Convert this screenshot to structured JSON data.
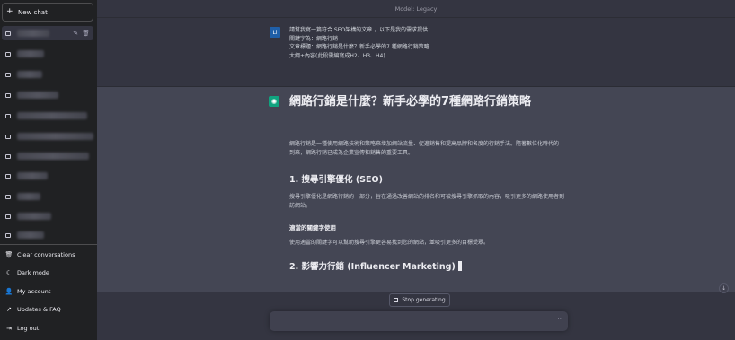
{
  "sidebar": {
    "new_chat_label": "New chat",
    "new_chat_icon": "plus-icon",
    "conversations": [
      {
        "label": "",
        "active": true
      },
      {
        "label": "",
        "active": false
      },
      {
        "label": "",
        "active": false
      },
      {
        "label": "",
        "active": false
      },
      {
        "label": "",
        "active": false
      },
      {
        "label": "",
        "active": false
      },
      {
        "label": "",
        "active": false
      },
      {
        "label": "",
        "active": false
      },
      {
        "label": "",
        "active": false
      },
      {
        "label": "",
        "active": false
      },
      {
        "label": "",
        "active": false
      }
    ],
    "menu": [
      {
        "icon": "trash-icon",
        "label": "Clear conversations"
      },
      {
        "icon": "moon-icon",
        "label": "Dark mode"
      },
      {
        "icon": "user-icon",
        "label": "My account"
      },
      {
        "icon": "external-link-icon",
        "label": "Updates & FAQ"
      },
      {
        "icon": "logout-icon",
        "label": "Log out"
      }
    ]
  },
  "header": {
    "model_label": "Model: Legacy"
  },
  "user_message": {
    "avatar": "Li",
    "lines": [
      "請幫我寫一篇符合 SEO架構的文章 ，以下是我的需求提供：",
      "關鍵字為：網路行銷",
      "文章標題：網路行銷是什麼？新手必學的7 種網路行銷策略",
      "大綱+內容(此段需編寫成H2、H3、H4)"
    ]
  },
  "assistant_message": {
    "title": "網路行銷是什麼？新手必學的7種網路行銷策略",
    "intro": "網路行銷是一種使用網路技術和策略來增加網站流量、促進銷售和提高品牌和名度的行銷手法。隨著數位化時代的到來，網路行銷已成為企業宣傳和銷售的重要工具。",
    "h2_seo": "1. 搜尋引擎優化 (SEO)",
    "seo_text": "搜尋引擎優化是網路行銷的一部分，旨在通過改善網站的排名和可被搜尋引擎抓取的內容，吸引更多的網路使用者到訪網站。",
    "h3_keywords": "適當的關鍵字使用",
    "keywords_text": "使用適當的關鍵字可以幫助搜尋引擎更容易找到您的網站，並吸引更多的目標受眾。",
    "h2_influencer": "2. 影響力行銷 (Influencer Marketing)"
  },
  "controls": {
    "stop_label": "Stop generating",
    "input_placeholder": "",
    "send_icon": "more-dots-icon"
  },
  "colors": {
    "sidebar_bg": "#202123",
    "main_bg": "#343541",
    "assistant_bg": "#444654",
    "gpt_green": "#10a37f"
  }
}
